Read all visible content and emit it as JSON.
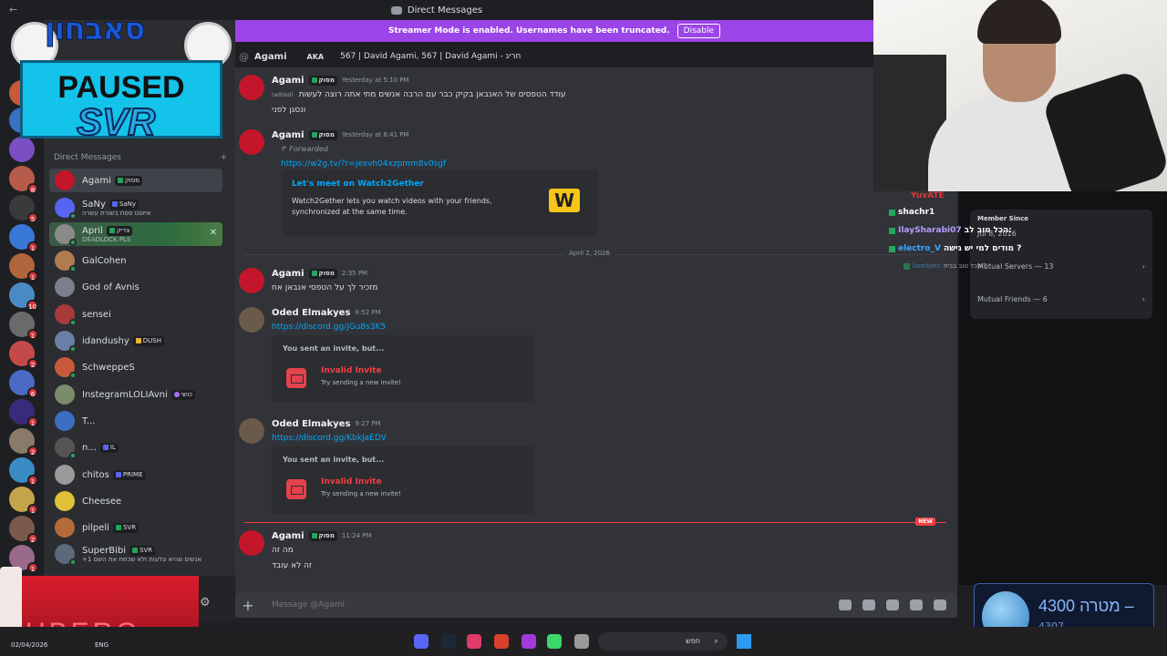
{
  "titlebar": {
    "title": "Direct Messages",
    "back": "←"
  },
  "banner": {
    "text": "Streamer Mode is enabled. Usernames have been truncated.",
    "button": "Disable"
  },
  "overlay": {
    "hebrew_title": "סאבחון",
    "paused": "PAUSED",
    "svr": "SVR"
  },
  "dm_list": {
    "header": "Direct Messages",
    "add": "+",
    "items": [
      {
        "name": "Agami",
        "tag": "מסוק",
        "sub": "",
        "color": "#c4162a"
      },
      {
        "name": "SaNy",
        "tag": "SaNy",
        "sub": "איזונט פסח בשורת עשרה",
        "color": "#5865f2"
      },
      {
        "name": "April",
        "tag": "צדיק",
        "sub": "DEADLOCK PLS",
        "color": "#8a8a8a"
      },
      {
        "name": "GalCohen",
        "tag": "",
        "sub": "",
        "color": "#b07c4f"
      },
      {
        "name": "God of Avnis",
        "tag": "",
        "sub": "",
        "color": "#7a7f8a"
      },
      {
        "name": "sensei",
        "tag": "",
        "sub": "",
        "color": "#a83a3a"
      },
      {
        "name": "idandushy",
        "tag": "DUSH",
        "sub": "",
        "color": "#6b7fa6"
      },
      {
        "name": "SchweppeS",
        "tag": "",
        "sub": "",
        "color": "#c75a3a"
      },
      {
        "name": "InstegramLOLIAvni",
        "tag": "כושי",
        "sub": "",
        "color": "#7b8c6a"
      },
      {
        "name": "T...",
        "tag": "",
        "sub": "",
        "color": "#3a6fc4"
      },
      {
        "name": "n...",
        "tag": "IL",
        "sub": "",
        "color": "#555"
      },
      {
        "name": "chitos",
        "tag": "PRIME",
        "sub": "",
        "color": "#9a9a9a"
      },
      {
        "name": "Cheesee",
        "tag": "",
        "sub": "",
        "color": "#e0c23a"
      },
      {
        "name": "pilpeli",
        "tag": "SVR",
        "sub": "",
        "color": "#b56a3a"
      },
      {
        "name": "SuperBibi",
        "tag": "SVR",
        "sub": "+1 אנשים שהיא צלעות ולא שכחת את השם",
        "color": "#5a6a7a"
      }
    ]
  },
  "chat_header": {
    "at": "@",
    "name": "Agami",
    "aka": "AKA",
    "aka_text": "567 | David Agami, 567 | David Agami - חריג"
  },
  "messages": [
    {
      "author": "Agami",
      "tag": "מסוק",
      "time": "Yesterday at 5:10 PM",
      "edited": "(edited)",
      "lines": [
        "עודד הטפסים של האנבאן בקיק כבר עם הרבה אנשים מתי אתה רוצה לעשות",
        "ונסגן לפני"
      ]
    },
    {
      "author": "Agami",
      "tag": "מסוק",
      "time": "Yesterday at 6:41 PM",
      "forwarded": "↱ Forwarded",
      "link": "https://w2g.tv/?r=jexvh04xzpmm8v0sgf",
      "embed_title": "Let's meet on Watch2Gether",
      "embed_desc": "Watch2Gether lets you watch videos with your friends, synchronized at the same time.",
      "embed_logo": "W"
    },
    {
      "author": "Agami",
      "tag": "מסוק",
      "time": "2:35 PM",
      "lines": [
        "מזכיר לך על הטפסי אנבאן אח"
      ]
    },
    {
      "author": "Oded Elmakyes",
      "time": "8:52 PM",
      "link": "https://discord.gg/jGu8s3K5",
      "invite_title": "You sent an invite, but...",
      "invite_name": "Invalid Invite",
      "invite_sub": "Try sending a new invite!"
    },
    {
      "author": "Oded Elmakyes",
      "time": "9:27 PM",
      "link": "https://discord.gg/KbkJaEDV",
      "invite_title": "You sent an invite, but...",
      "invite_name": "Invalid Invite",
      "invite_sub": "Try sending a new invite!"
    },
    {
      "author": "Agami",
      "tag": "מסוק",
      "time": "11:24 PM",
      "lines": [
        "מה זה",
        "זה לא עובד"
      ]
    }
  ],
  "date_divider": "April 2, 2026",
  "new_badge": "NEW",
  "input": {
    "placeholder": "Message @Agami",
    "plus": "+"
  },
  "right_panel": {
    "member_since": "Member Since",
    "since_date": "Jul 8, 2016",
    "mutual_servers": "Mutual Servers — 13",
    "mutual_friends": "Mutual Friends — 6"
  },
  "twitch_chat": [
    {
      "user": "YuvATE",
      "msg": ""
    },
    {
      "user": "shachr1",
      "msg": ""
    },
    {
      "user": "IlaySharabi07",
      "msg": "הכל טוב לב:"
    },
    {
      "user": "electro_V",
      "msg": "מודים למי יש גישה ?"
    },
    {
      "user": "liambeth",
      "msg": "הכל טוב בבית ?"
    }
  ],
  "goal": {
    "amount": "4300",
    "label": "מטרה –",
    "current": "4307"
  },
  "taskbar": {
    "search": "חפש",
    "date": "02/04/2026",
    "lang": "ENG"
  },
  "promo": {
    "text": "UBERO"
  }
}
